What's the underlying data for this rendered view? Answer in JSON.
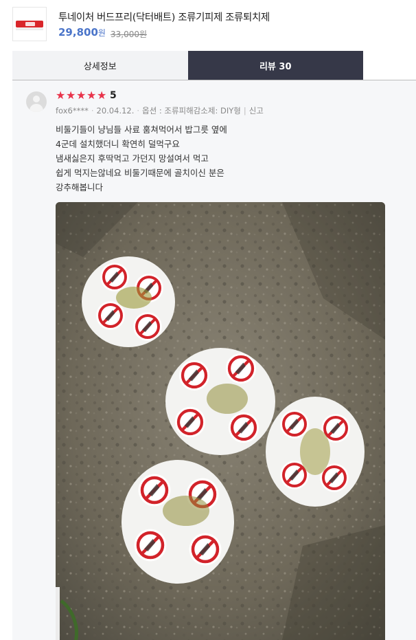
{
  "product": {
    "title": "투네이처 버드프리(닥터배트) 조류기피제 조류퇴치제",
    "price": "29,800",
    "price_unit": "원",
    "original_price": "33,000원",
    "thumbnail_icon": "product-thumbnail-icon"
  },
  "tabs": [
    {
      "label": "상세정보",
      "active": false
    },
    {
      "label": "리뷰 30",
      "active": true
    }
  ],
  "review": {
    "rating": "5",
    "stars": 5,
    "author": "fox6****",
    "date": "20.04.12.",
    "option": "옵션 : 조류피해감소제: DIY형",
    "report": "신고",
    "lines": [
      "비둘기들이 냥님들 사료 훔쳐먹어서 밥그릇 옆에",
      "4군데 설치했더니 확연히 덜먹구요",
      "냄새싫은지  후딱먹고 가던지 망설여서 먹고",
      "쉽게 먹지는않네요 비둘기때문에  골치이신  분은",
      "강추해봅니다"
    ]
  },
  "colors": {
    "accent_price": "#4a74c9",
    "star": "#e8334a",
    "active_tab_bg": "#363848",
    "inactive_tab_bg": "#f2f3f5",
    "review_bg": "#f6f7f9"
  }
}
